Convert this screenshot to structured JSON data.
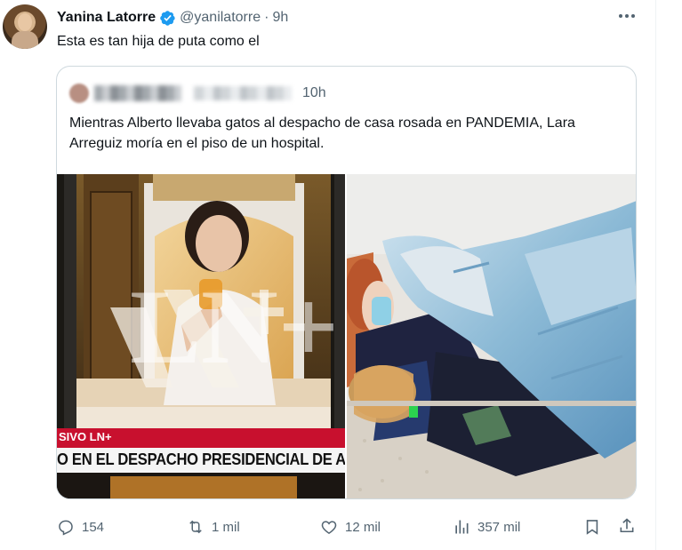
{
  "post": {
    "author": {
      "name": "Yanina Latorre",
      "handle": "@yanilatorre",
      "verified_icon": "verified-badge-icon"
    },
    "separator": "·",
    "time": "9h",
    "text": "Esta es tan hija de puta como el",
    "more_icon": "more-options-icon"
  },
  "quoted": {
    "time": "10h",
    "text": "Mientras Alberto llevaba gatos al despacho de casa rosada en PANDEMIA, Lara Arreguiz moría en el piso de un hospital.",
    "media_left": {
      "watermark": "LN+",
      "banner_top": "SIVO LN+",
      "banner_bottom": "O EN EL DESPACHO PRESIDENCIAL DE ALI"
    }
  },
  "actions": {
    "replies": "154",
    "reposts": "1 mil",
    "likes": "12 mil",
    "views": "357 mil"
  },
  "colors": {
    "text": "#0f1419",
    "secondary": "#536471",
    "verified": "#1d9bf0",
    "border": "#cfd9de",
    "news_red": "#c8102e"
  }
}
